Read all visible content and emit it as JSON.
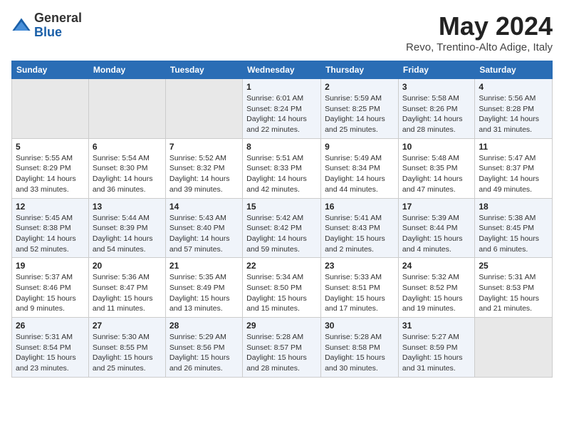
{
  "logo": {
    "general": "General",
    "blue": "Blue"
  },
  "title": "May 2024",
  "subtitle": "Revo, Trentino-Alto Adige, Italy",
  "days_of_week": [
    "Sunday",
    "Monday",
    "Tuesday",
    "Wednesday",
    "Thursday",
    "Friday",
    "Saturday"
  ],
  "weeks": [
    [
      {
        "day": "",
        "sunrise": "",
        "sunset": "",
        "daylight": ""
      },
      {
        "day": "",
        "sunrise": "",
        "sunset": "",
        "daylight": ""
      },
      {
        "day": "",
        "sunrise": "",
        "sunset": "",
        "daylight": ""
      },
      {
        "day": "1",
        "sunrise": "Sunrise: 6:01 AM",
        "sunset": "Sunset: 8:24 PM",
        "daylight": "Daylight: 14 hours and 22 minutes."
      },
      {
        "day": "2",
        "sunrise": "Sunrise: 5:59 AM",
        "sunset": "Sunset: 8:25 PM",
        "daylight": "Daylight: 14 hours and 25 minutes."
      },
      {
        "day": "3",
        "sunrise": "Sunrise: 5:58 AM",
        "sunset": "Sunset: 8:26 PM",
        "daylight": "Daylight: 14 hours and 28 minutes."
      },
      {
        "day": "4",
        "sunrise": "Sunrise: 5:56 AM",
        "sunset": "Sunset: 8:28 PM",
        "daylight": "Daylight: 14 hours and 31 minutes."
      }
    ],
    [
      {
        "day": "5",
        "sunrise": "Sunrise: 5:55 AM",
        "sunset": "Sunset: 8:29 PM",
        "daylight": "Daylight: 14 hours and 33 minutes."
      },
      {
        "day": "6",
        "sunrise": "Sunrise: 5:54 AM",
        "sunset": "Sunset: 8:30 PM",
        "daylight": "Daylight: 14 hours and 36 minutes."
      },
      {
        "day": "7",
        "sunrise": "Sunrise: 5:52 AM",
        "sunset": "Sunset: 8:32 PM",
        "daylight": "Daylight: 14 hours and 39 minutes."
      },
      {
        "day": "8",
        "sunrise": "Sunrise: 5:51 AM",
        "sunset": "Sunset: 8:33 PM",
        "daylight": "Daylight: 14 hours and 42 minutes."
      },
      {
        "day": "9",
        "sunrise": "Sunrise: 5:49 AM",
        "sunset": "Sunset: 8:34 PM",
        "daylight": "Daylight: 14 hours and 44 minutes."
      },
      {
        "day": "10",
        "sunrise": "Sunrise: 5:48 AM",
        "sunset": "Sunset: 8:35 PM",
        "daylight": "Daylight: 14 hours and 47 minutes."
      },
      {
        "day": "11",
        "sunrise": "Sunrise: 5:47 AM",
        "sunset": "Sunset: 8:37 PM",
        "daylight": "Daylight: 14 hours and 49 minutes."
      }
    ],
    [
      {
        "day": "12",
        "sunrise": "Sunrise: 5:45 AM",
        "sunset": "Sunset: 8:38 PM",
        "daylight": "Daylight: 14 hours and 52 minutes."
      },
      {
        "day": "13",
        "sunrise": "Sunrise: 5:44 AM",
        "sunset": "Sunset: 8:39 PM",
        "daylight": "Daylight: 14 hours and 54 minutes."
      },
      {
        "day": "14",
        "sunrise": "Sunrise: 5:43 AM",
        "sunset": "Sunset: 8:40 PM",
        "daylight": "Daylight: 14 hours and 57 minutes."
      },
      {
        "day": "15",
        "sunrise": "Sunrise: 5:42 AM",
        "sunset": "Sunset: 8:42 PM",
        "daylight": "Daylight: 14 hours and 59 minutes."
      },
      {
        "day": "16",
        "sunrise": "Sunrise: 5:41 AM",
        "sunset": "Sunset: 8:43 PM",
        "daylight": "Daylight: 15 hours and 2 minutes."
      },
      {
        "day": "17",
        "sunrise": "Sunrise: 5:39 AM",
        "sunset": "Sunset: 8:44 PM",
        "daylight": "Daylight: 15 hours and 4 minutes."
      },
      {
        "day": "18",
        "sunrise": "Sunrise: 5:38 AM",
        "sunset": "Sunset: 8:45 PM",
        "daylight": "Daylight: 15 hours and 6 minutes."
      }
    ],
    [
      {
        "day": "19",
        "sunrise": "Sunrise: 5:37 AM",
        "sunset": "Sunset: 8:46 PM",
        "daylight": "Daylight: 15 hours and 9 minutes."
      },
      {
        "day": "20",
        "sunrise": "Sunrise: 5:36 AM",
        "sunset": "Sunset: 8:47 PM",
        "daylight": "Daylight: 15 hours and 11 minutes."
      },
      {
        "day": "21",
        "sunrise": "Sunrise: 5:35 AM",
        "sunset": "Sunset: 8:49 PM",
        "daylight": "Daylight: 15 hours and 13 minutes."
      },
      {
        "day": "22",
        "sunrise": "Sunrise: 5:34 AM",
        "sunset": "Sunset: 8:50 PM",
        "daylight": "Daylight: 15 hours and 15 minutes."
      },
      {
        "day": "23",
        "sunrise": "Sunrise: 5:33 AM",
        "sunset": "Sunset: 8:51 PM",
        "daylight": "Daylight: 15 hours and 17 minutes."
      },
      {
        "day": "24",
        "sunrise": "Sunrise: 5:32 AM",
        "sunset": "Sunset: 8:52 PM",
        "daylight": "Daylight: 15 hours and 19 minutes."
      },
      {
        "day": "25",
        "sunrise": "Sunrise: 5:31 AM",
        "sunset": "Sunset: 8:53 PM",
        "daylight": "Daylight: 15 hours and 21 minutes."
      }
    ],
    [
      {
        "day": "26",
        "sunrise": "Sunrise: 5:31 AM",
        "sunset": "Sunset: 8:54 PM",
        "daylight": "Daylight: 15 hours and 23 minutes."
      },
      {
        "day": "27",
        "sunrise": "Sunrise: 5:30 AM",
        "sunset": "Sunset: 8:55 PM",
        "daylight": "Daylight: 15 hours and 25 minutes."
      },
      {
        "day": "28",
        "sunrise": "Sunrise: 5:29 AM",
        "sunset": "Sunset: 8:56 PM",
        "daylight": "Daylight: 15 hours and 26 minutes."
      },
      {
        "day": "29",
        "sunrise": "Sunrise: 5:28 AM",
        "sunset": "Sunset: 8:57 PM",
        "daylight": "Daylight: 15 hours and 28 minutes."
      },
      {
        "day": "30",
        "sunrise": "Sunrise: 5:28 AM",
        "sunset": "Sunset: 8:58 PM",
        "daylight": "Daylight: 15 hours and 30 minutes."
      },
      {
        "day": "31",
        "sunrise": "Sunrise: 5:27 AM",
        "sunset": "Sunset: 8:59 PM",
        "daylight": "Daylight: 15 hours and 31 minutes."
      },
      {
        "day": "",
        "sunrise": "",
        "sunset": "",
        "daylight": ""
      }
    ]
  ]
}
